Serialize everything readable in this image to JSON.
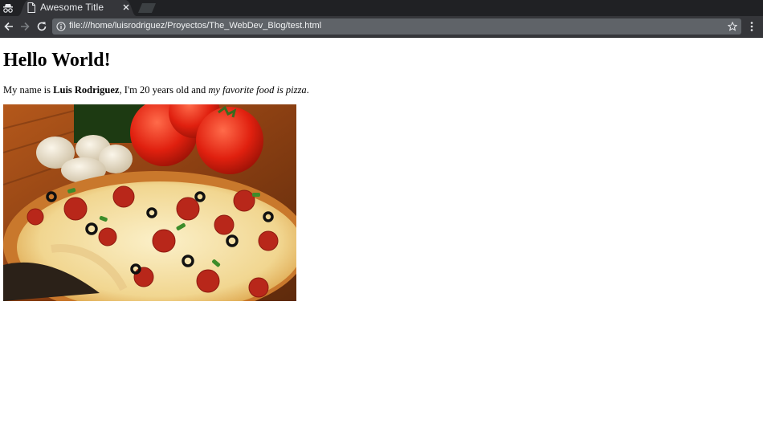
{
  "browser": {
    "tab_title": "Awesome Title",
    "url": "file:///home/luisrodriguez/Proyectos/The_WebDev_Blog/test.html",
    "icons": [
      "incognito-icon",
      "page-icon",
      "close-icon",
      "new-tab-icon",
      "back-icon",
      "forward-icon",
      "reload-icon",
      "info-icon",
      "star-icon",
      "menu-icon"
    ]
  },
  "page": {
    "heading": "Hello World!",
    "intro": {
      "prefix": "My name is ",
      "name": "Luis Rodriguez",
      "middle": ", I'm 20 years old and ",
      "food_phrase": "my favorite food is pizza",
      "suffix": "."
    },
    "image": {
      "subject": "pizza"
    }
  },
  "colors": {
    "tabstrip": "#202124",
    "toolbar": "#35363a",
    "omnibox": "#5f6368",
    "page_bg": "#ffffff"
  }
}
